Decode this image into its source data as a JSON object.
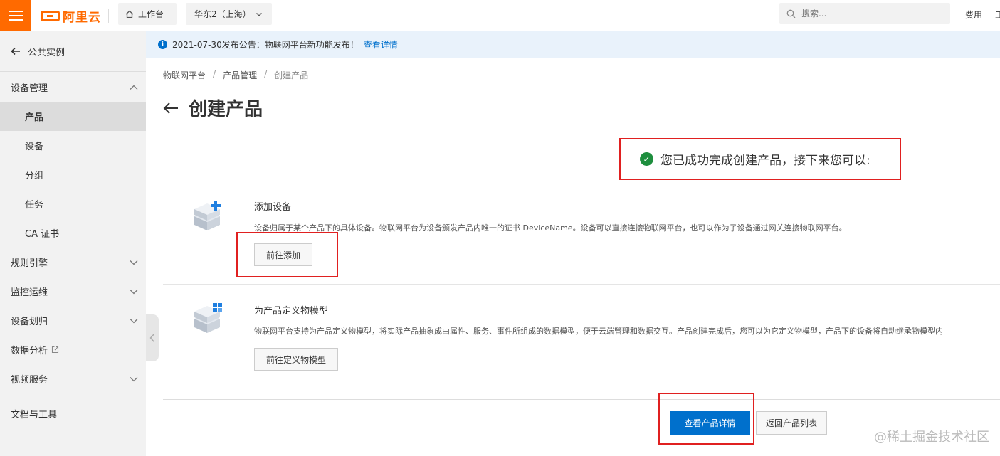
{
  "topbar": {
    "logo_text": "阿里云",
    "workbench_label": "工作台",
    "region_label": "华东2（上海）",
    "search_placeholder": "搜索...",
    "fees_label": "费用",
    "cut_link": "工"
  },
  "sidebar": {
    "back_label": "公共实例",
    "groups": {
      "device_mgmt": {
        "label": "设备管理",
        "items": [
          "产品",
          "设备",
          "分组",
          "任务",
          "CA 证书"
        ],
        "active": "产品"
      },
      "rules": "规则引擎",
      "monitoring": "监控运维",
      "device_assign": "设备划归",
      "data_analysis": "数据分析",
      "video": "视频服务"
    },
    "docs_label": "文档与工具"
  },
  "notice": {
    "text": "2021-07-30发布公告：物联网平台新功能发布！",
    "link": "查看详情"
  },
  "breadcrumb": [
    "物联网平台",
    "产品管理",
    "创建产品"
  ],
  "page_title": "创建产品",
  "success_message": "您已成功完成创建产品，接下来您可以:",
  "steps": [
    {
      "title": "添加设备",
      "description": "设备归属于某个产品下的具体设备。物联网平台为设备颁发产品内唯一的证书 DeviceName。设备可以直接连接物联网平台，也可以作为子设备通过网关连接物联网平台。",
      "button": "前往添加"
    },
    {
      "title": "为产品定义物模型",
      "description": "物联网平台支持为产品定义物模型，将实际产品抽象成由属性、服务、事件所组成的数据模型，便于云端管理和数据交互。产品创建完成后，您可以为它定义物模型，产品下的设备将自动继承物模型内",
      "button": "前往定义物模型"
    }
  ],
  "actions": {
    "primary": "查看产品详情",
    "secondary": "返回产品列表"
  },
  "watermark": "@稀土掘金技术社区",
  "colors": {
    "brand": "#ff6a00",
    "primary": "#0070cc",
    "success": "#1e8e3e",
    "highlight": "#e02020"
  }
}
